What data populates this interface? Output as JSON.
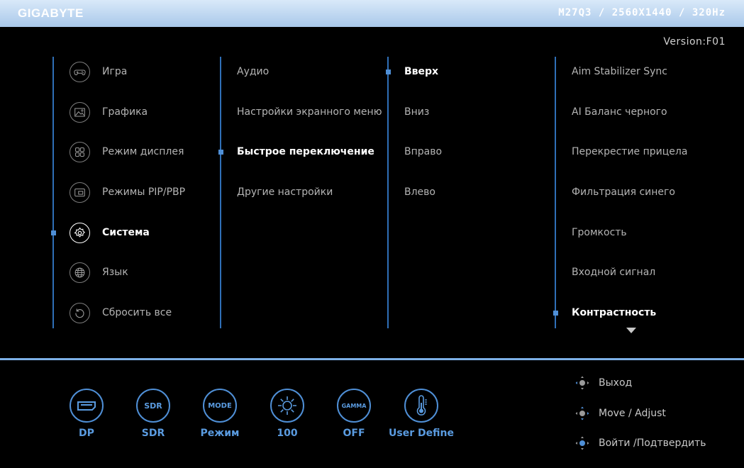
{
  "header": {
    "brand": "GIGABYTE",
    "model_info": "M27Q3 / 2560X1440 / 320Hz",
    "version": "Version:F01"
  },
  "menu": {
    "main": [
      {
        "label": "Игра",
        "icon": "gamepad-icon",
        "selected": false
      },
      {
        "label": "Графика",
        "icon": "picture-icon",
        "selected": false
      },
      {
        "label": "Режим дисплея",
        "icon": "grid-icon",
        "selected": false
      },
      {
        "label": "Режимы PIP/PBP",
        "icon": "pip-icon",
        "selected": false
      },
      {
        "label": "Система",
        "icon": "gear-icon",
        "selected": true
      },
      {
        "label": "Язык",
        "icon": "globe-icon",
        "selected": false
      },
      {
        "label": "Сбросить все",
        "icon": "reset-icon",
        "selected": false
      }
    ],
    "sub": [
      {
        "label": "Аудио",
        "selected": false
      },
      {
        "label": "Настройки экранного меню",
        "selected": false
      },
      {
        "label": "Быстрое переключение",
        "selected": true
      },
      {
        "label": "Другие настройки",
        "selected": false
      }
    ],
    "direction": [
      {
        "label": "Вверх",
        "selected": true
      },
      {
        "label": "Вниз",
        "selected": false
      },
      {
        "label": "Вправо",
        "selected": false
      },
      {
        "label": "Влево",
        "selected": false
      }
    ],
    "options": [
      {
        "label": "Aim Stabilizer Sync",
        "selected": false
      },
      {
        "label": "AI Баланс черного",
        "selected": false
      },
      {
        "label": "Перекрестие прицела",
        "selected": false
      },
      {
        "label": "Фильтрация синего",
        "selected": false
      },
      {
        "label": "Громкость",
        "selected": false
      },
      {
        "label": "Входной сигнал",
        "selected": false
      },
      {
        "label": "Контрастность",
        "selected": true
      }
    ]
  },
  "quick_status": [
    {
      "icon_text": "",
      "icon": "displayport-icon",
      "label": "DP"
    },
    {
      "icon_text": "SDR",
      "icon": "sdr-icon",
      "label": "SDR"
    },
    {
      "icon_text": "MODE",
      "icon": "mode-icon",
      "label": "Режим"
    },
    {
      "icon_text": "",
      "icon": "brightness-icon",
      "label": "100"
    },
    {
      "icon_text": "GAMMA",
      "icon": "gamma-icon",
      "label": "OFF"
    },
    {
      "icon_text": "",
      "icon": "thermometer-icon",
      "label": "User Define"
    }
  ],
  "hints": [
    {
      "label": "Выход",
      "icon": "joystick-left-icon"
    },
    {
      "label": "Move / Adjust",
      "icon": "joystick-move-icon"
    },
    {
      "label": "Войти /Подтвердить",
      "icon": "joystick-press-icon"
    }
  ],
  "colors": {
    "accent": "#4f8fd6",
    "header_gradient_top": "#d9e9f9",
    "header_gradient_bottom": "#a9c8ea",
    "background": "#000000"
  }
}
